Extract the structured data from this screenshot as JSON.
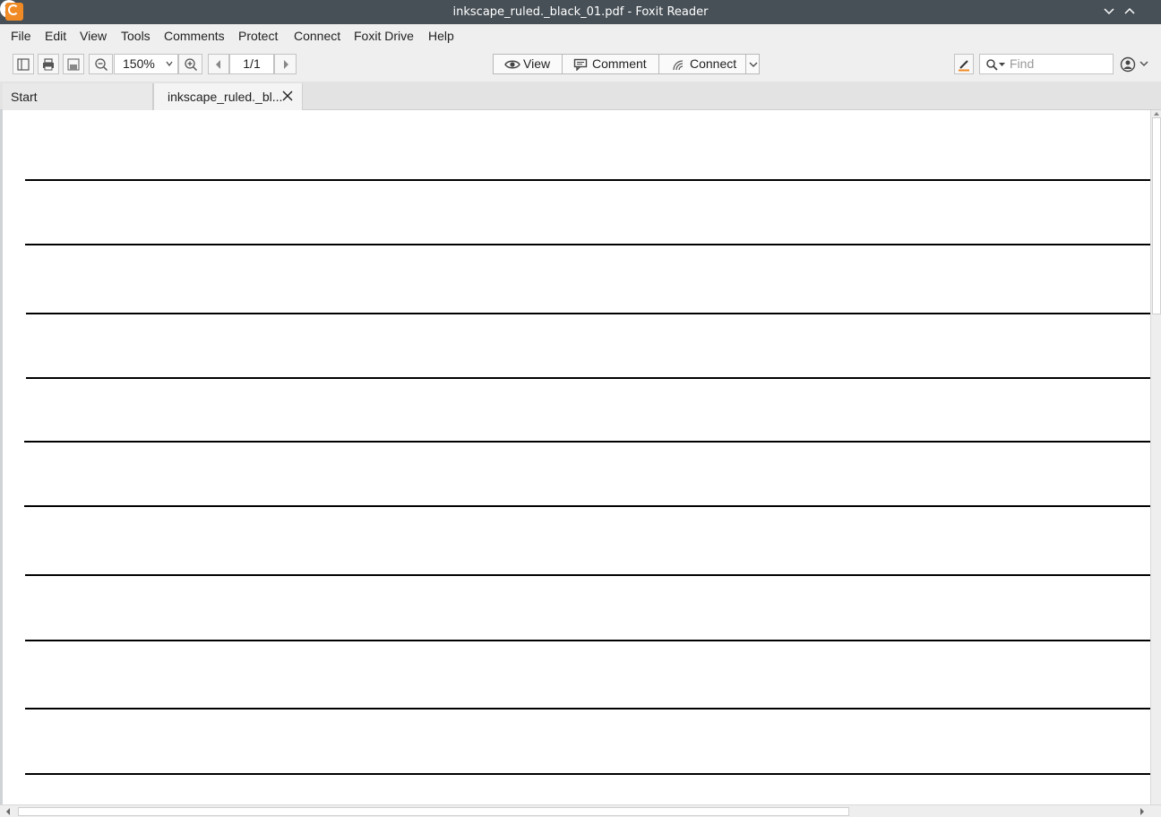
{
  "window": {
    "title": "inkscape_ruled._black_01.pdf - Foxit Reader"
  },
  "menu": {
    "items": [
      "File",
      "Edit",
      "View",
      "Tools",
      "Comments",
      "Protect",
      "Connect",
      "Foxit Drive",
      "Help"
    ]
  },
  "toolbar": {
    "zoom_value": "150%",
    "page_value": "1/1",
    "modes": {
      "view_label": "View",
      "comment_label": "Comment",
      "connect_label": "Connect"
    },
    "find_placeholder": "Find"
  },
  "tabs": {
    "start_label": "Start",
    "doc_label": "inkscape_ruled._bl..."
  },
  "document": {
    "ruled_line_count": 10
  },
  "icons": {
    "app": "foxit-logo-icon",
    "minimize": "chevron-down-icon",
    "maximize": "chevron-up-icon",
    "close": "close-icon"
  },
  "colors": {
    "titlebar": "#475057",
    "accent": "#f08a24",
    "ruled_line": "#000000"
  }
}
